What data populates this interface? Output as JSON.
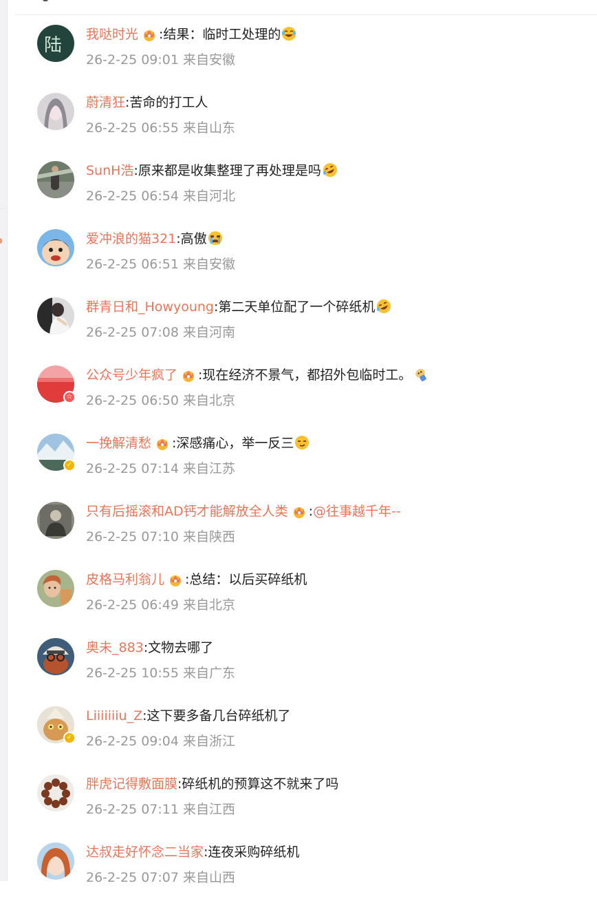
{
  "comments": [
    {
      "username": "我哒时光",
      "crown": true,
      "colon": ":",
      "text": "结果：临时工处理的",
      "emoji": "laugh-tears-emoji",
      "time": "26-2-25 09:01",
      "location": "来自安徽",
      "avatar": "avatar-image",
      "badge": ""
    },
    {
      "username": "蔚清狂",
      "crown": false,
      "colon": ":",
      "text": "苦命的打工人",
      "emoji": "",
      "time": "26-2-25 06:55",
      "location": "来自山东",
      "avatar": "avatar-image",
      "badge": ""
    },
    {
      "username": "SunH浩",
      "crown": false,
      "colon": ":",
      "text": "原来都是收集整理了再处理是吗",
      "emoji": "rolling-laugh-emoji",
      "time": "26-2-25 06:54",
      "location": "来自河北",
      "avatar": "avatar-image",
      "badge": ""
    },
    {
      "username": "爱冲浪的猫321",
      "crown": false,
      "colon": ":",
      "text": "高傲",
      "emoji": "crying-emoji",
      "time": "26-2-25 06:51",
      "location": "来自安徽",
      "avatar": "avatar-image",
      "badge": ""
    },
    {
      "username": "群青日和_Howyoung",
      "crown": false,
      "colon": ":",
      "text": "第二天单位配了一个碎纸机",
      "emoji": "rolling-laugh-emoji",
      "time": "26-2-25 07:08",
      "location": "来自河南",
      "avatar": "avatar-image",
      "badge": ""
    },
    {
      "username": "公众号少年疯了",
      "crown": true,
      "colon": ":",
      "text": "现在经济不景气，都招外包临时工。",
      "emoji": "dog-emoji",
      "time": "26-2-25 06:50",
      "location": "来自北京",
      "avatar": "avatar-image",
      "badge": "red"
    },
    {
      "username": "一挽解清愁",
      "crown": true,
      "colon": ":",
      "text": "深感痛心，举一反三",
      "emoji": "smirk-emoji",
      "time": "26-2-25 07:14",
      "location": "来自江苏",
      "avatar": "avatar-image",
      "badge": "gold"
    },
    {
      "username": "只有后摇滚和AD钙才能解放全人类",
      "crown": true,
      "colon": ":",
      "text": "",
      "mention": "@往事越千年--",
      "emoji": "",
      "time": "26-2-25 07:10",
      "location": "来自陕西",
      "avatar": "avatar-image",
      "badge": ""
    },
    {
      "username": "皮格马利翁儿",
      "crown": true,
      "colon": ":",
      "text": "总结：以后买碎纸机",
      "emoji": "",
      "time": "26-2-25 06:49",
      "location": "来自北京",
      "avatar": "avatar-image",
      "badge": ""
    },
    {
      "username": "奥未_883",
      "crown": false,
      "colon": ":",
      "text": "文物去哪了",
      "emoji": "",
      "time": "26-2-25 10:55",
      "location": "来自广东",
      "avatar": "avatar-image",
      "badge": ""
    },
    {
      "username": "Liiiiiiiu_Z",
      "crown": false,
      "colon": ":",
      "text": "这下要多备几台碎纸机了",
      "emoji": "",
      "time": "26-2-25 09:04",
      "location": "来自浙江",
      "avatar": "avatar-image",
      "badge": "gold"
    },
    {
      "username": "胖虎记得敷面膜",
      "crown": false,
      "colon": ":",
      "text": "碎纸机的预算这不就来了吗",
      "emoji": "",
      "time": "26-2-25 07:11",
      "location": "来自江西",
      "avatar": "avatar-image",
      "badge": ""
    },
    {
      "username": "达叔走好怀念二当家",
      "crown": false,
      "colon": ":",
      "text": "连夜采购碎纸机",
      "emoji": "",
      "time": "26-2-25 07:07",
      "location": "来自山西",
      "avatar": "avatar-image",
      "badge": ""
    }
  ],
  "colors": {
    "username": "#e8765a",
    "text": "#222222",
    "meta": "#999999"
  }
}
